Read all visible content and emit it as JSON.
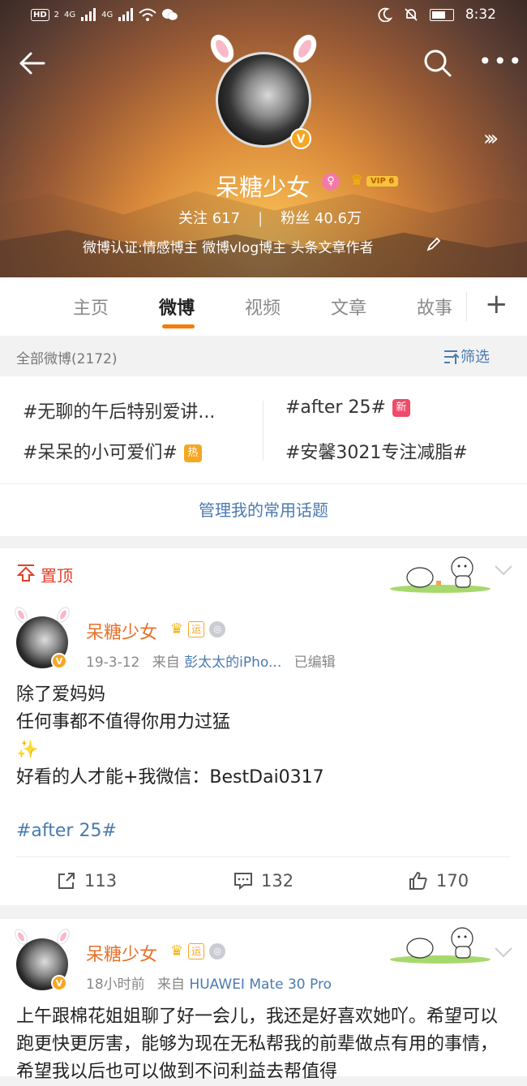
{
  "status": {
    "time": "8:32",
    "hd": "HD",
    "sim1": "2",
    "net1": "4G",
    "net2": "4G"
  },
  "profile": {
    "name": "呆糖少女",
    "vip": "VIP 6",
    "follow_label": "关注",
    "follow_count": "617",
    "fans_label": "粉丝",
    "fans_count": "40.6万",
    "verify": "微博认证:情感博主 微博vlog博主 头条文章作者"
  },
  "tabs": [
    "主页",
    "微博",
    "视频",
    "文章",
    "故事"
  ],
  "active_tab": "微博",
  "filter": {
    "count_label": "全部微博(2172)",
    "button": "筛选"
  },
  "topics": [
    {
      "text": "#无聊的午后特别爱讲...",
      "badge": ""
    },
    {
      "text": "#after 25#",
      "badge": "新",
      "badge_color": "#f04a6a"
    },
    {
      "text": "#呆呆的小可爱们#",
      "badge": "热",
      "badge_color": "#f5a623"
    },
    {
      "text": "#安馨3021专注减脂#",
      "badge": ""
    }
  ],
  "manage_label": "管理我的常用话题",
  "pinned_label": "置顶",
  "badges": {
    "sq": "运"
  },
  "post1": {
    "name": "呆糖少女",
    "date": "19-3-12",
    "from_label": "来自",
    "source": "彭太太的iPho...",
    "edited": "已编辑",
    "lines": [
      "除了爱妈妈",
      "任何事都不值得你用力过猛",
      "✨",
      "好看的人才能+我微信：BestDai0317"
    ],
    "tag": "#after 25#",
    "reposts": "113",
    "comments": "132",
    "likes": "170"
  },
  "post2": {
    "name": "呆糖少女",
    "time": "18小时前",
    "from_label": "来自",
    "source": "HUAWEI Mate 30 Pro",
    "text": "上午跟棉花姐姐聊了好一会儿，我还是好喜欢她吖。希望可以跑更快更厉害，能够为现在无私帮我的前辈做点有用的事情，希望我以后也可以做到不问利益去帮值得"
  },
  "colors": {
    "accent": "#f77a0c",
    "link": "#4a7ab2",
    "pin": "#e0402a",
    "name": "#e8702a"
  }
}
